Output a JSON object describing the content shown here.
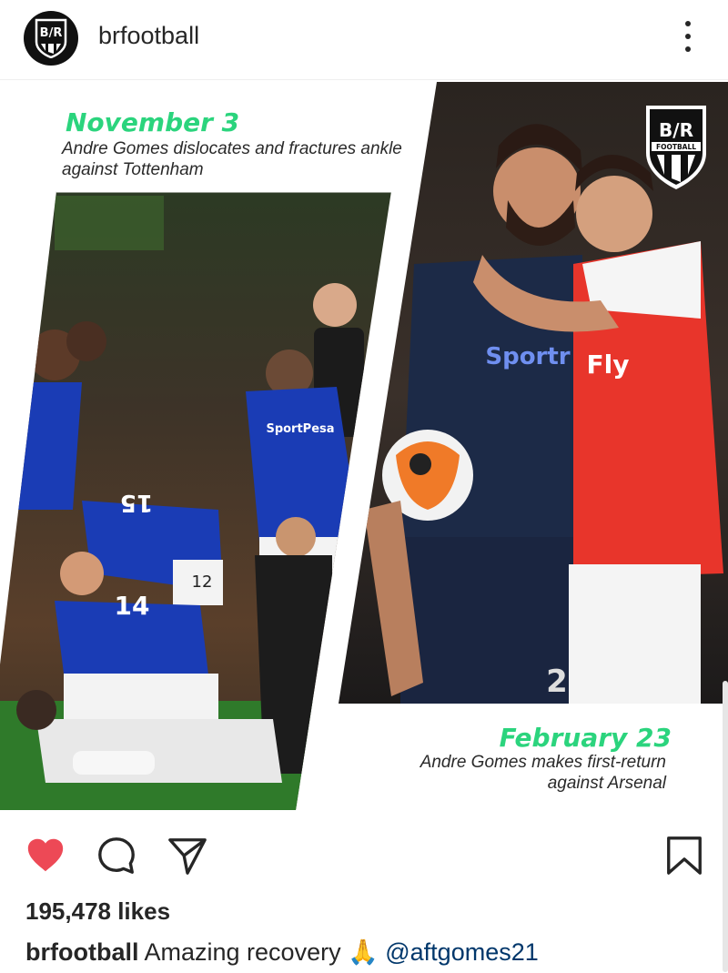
{
  "header": {
    "username": "brfootball",
    "avatar_icon": "br-logo-icon",
    "more_icon": "more-options-icon"
  },
  "post": {
    "logo_text_top": "B/R",
    "logo_text_bottom": "FOOTBALL",
    "left_panel": {
      "date": "November 3",
      "caption": "Andre Gomes dislocates and fractures ankle against Tottenham"
    },
    "right_panel": {
      "date": "February 23",
      "caption": "Andre Gomes makes first-return against Arsenal"
    },
    "colors": {
      "date_green": "#2bd47d",
      "everton_blue": "#1a3cb5",
      "arsenal_red": "#e8352b",
      "pitch_green": "#2f7a2a"
    }
  },
  "actions": {
    "like_icon": "heart-icon",
    "liked": true,
    "comment_icon": "comment-icon",
    "share_icon": "share-icon",
    "save_icon": "bookmark-icon"
  },
  "likes": "195,478 likes",
  "caption": {
    "username": "brfootball",
    "text": "Amazing recovery",
    "emoji": "🙏",
    "mention": "@aftgomes21"
  }
}
